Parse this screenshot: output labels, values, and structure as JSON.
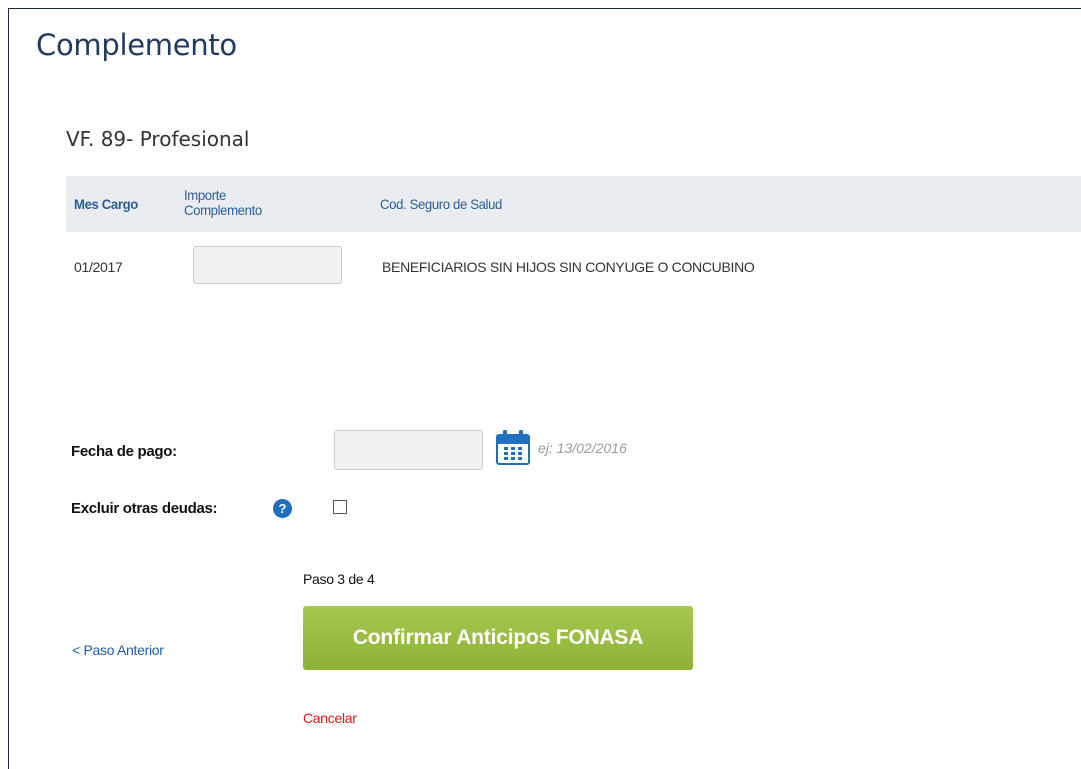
{
  "page": {
    "title": "Complemento",
    "subtitle": "VF. 89- Profesional"
  },
  "table": {
    "headers": {
      "mes_cargo": "Mes Cargo",
      "importe_line1": "Importe",
      "importe_line2": "Complemento",
      "cod_seguro": "Cod. Seguro de Salud"
    },
    "rows": [
      {
        "mes_cargo": "01/2017",
        "importe_value": "",
        "cod_seguro": "BENEFICIARIOS SIN HIJOS SIN CONYUGE O CONCUBINO"
      }
    ]
  },
  "form": {
    "fecha_label": "Fecha de pago:",
    "fecha_value": "",
    "fecha_hint": "ej: 13/02/2016",
    "excluir_label": "Excluir otras deudas:",
    "excluir_checked": false,
    "help_glyph": "?"
  },
  "wizard": {
    "step_text": "Paso 3 de 4",
    "prev_label": "< Paso Anterior",
    "confirm_label": "Confirmar Anticipos FONASA",
    "cancel_label": "Cancelar"
  },
  "colors": {
    "title": "#213a5f",
    "header_bg": "#e9edf2",
    "header_text": "#2e5d95",
    "confirm_button": "#9bbe45",
    "cancel_link": "#e01515",
    "prev_link": "#1f5da8",
    "help_icon": "#1f6fc0"
  },
  "icons": {
    "calendar": "calendar-icon",
    "help": "help-circle-icon"
  }
}
